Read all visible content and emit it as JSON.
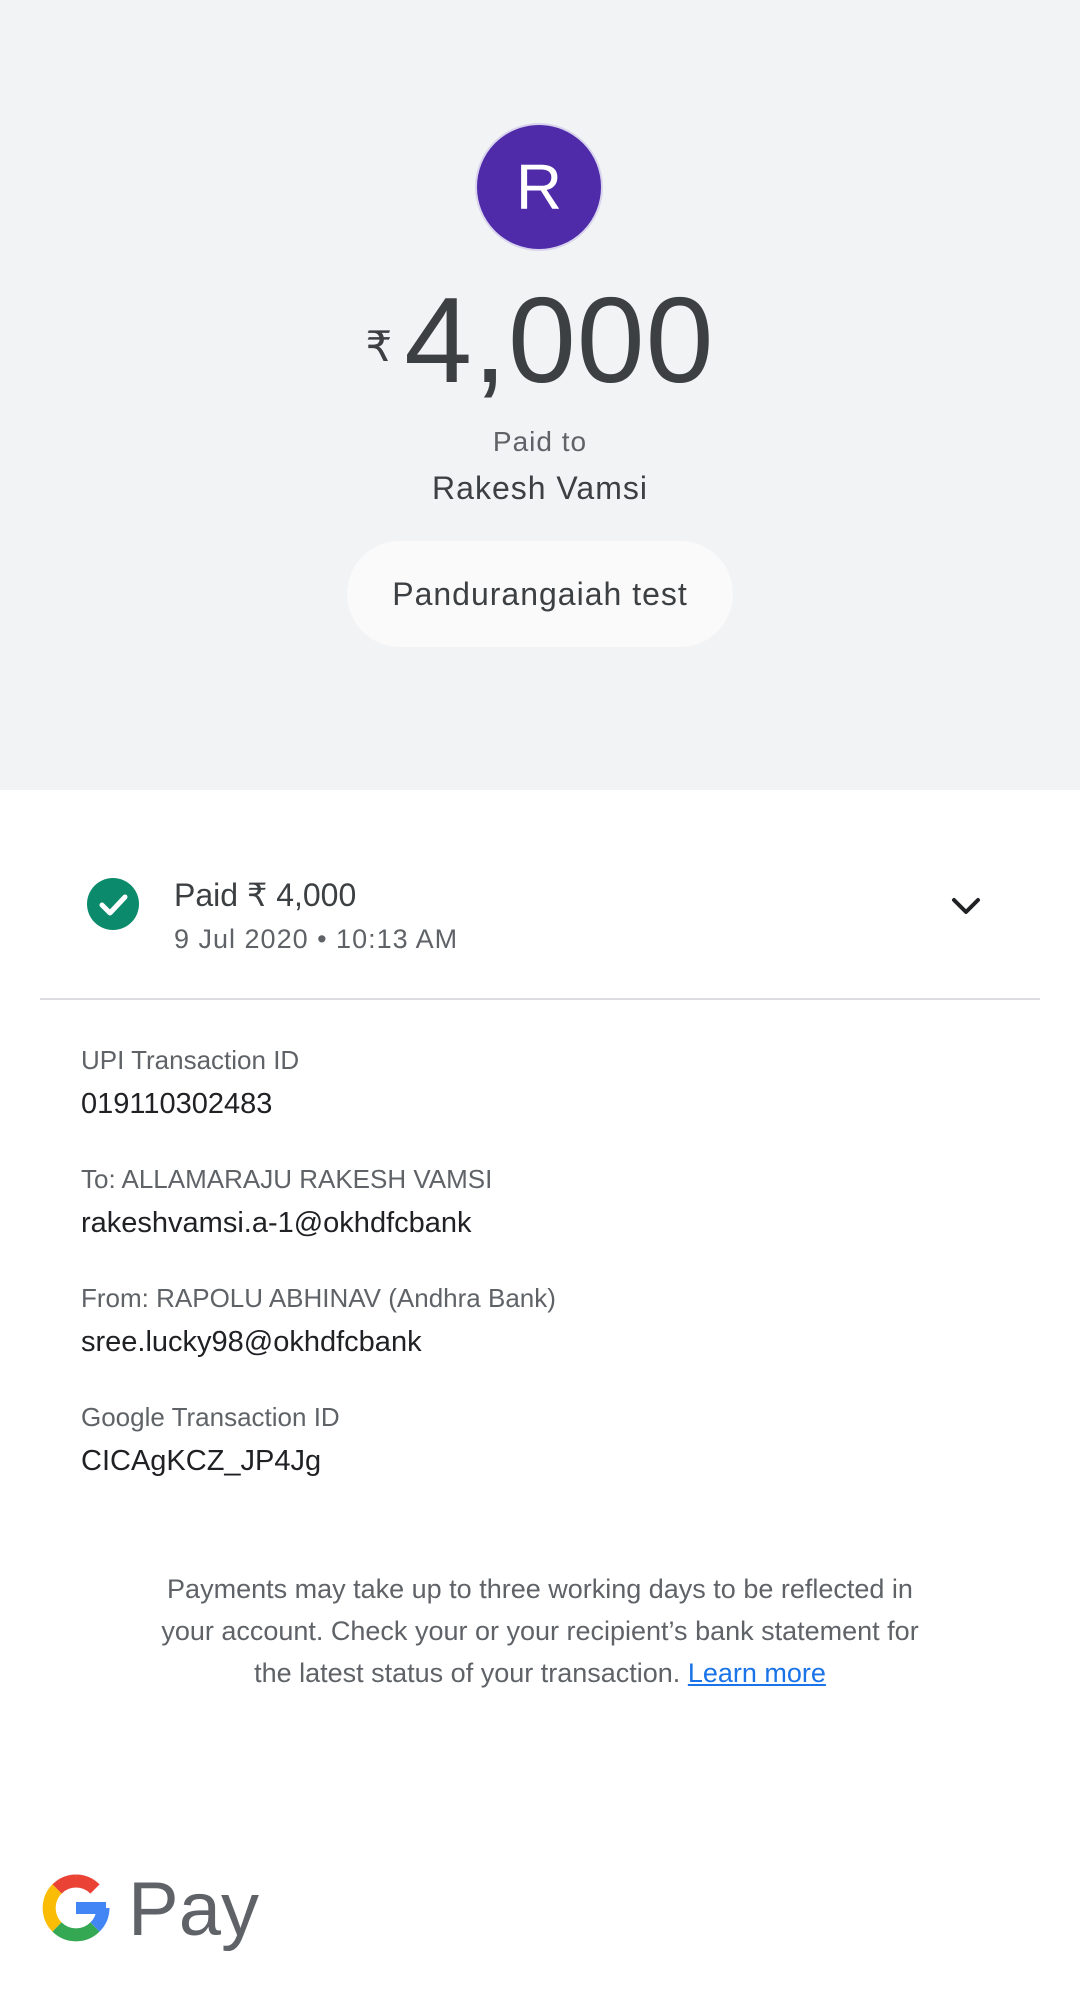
{
  "header": {
    "avatar_initial": "R",
    "avatar_color": "#4f2aa9",
    "currency_symbol": "₹",
    "amount": "4,000",
    "paid_to_label": "Paid to",
    "payee_name": "Rakesh Vamsi",
    "note": "Pandurangaiah test"
  },
  "status": {
    "title": "Paid ₹ 4,000",
    "datetime": "9 Jul 2020 • 10:13 AM",
    "icon": "check-circle-icon",
    "color": "#0b8a6c",
    "expand_icon": "chevron-down-icon"
  },
  "details": [
    {
      "label": "UPI Transaction ID",
      "value": "019110302483"
    },
    {
      "label": "To: ALLAMARAJU RAKESH VAMSI",
      "value": "rakeshvamsi.a-1@okhdfcbank"
    },
    {
      "label": "From: RAPOLU ABHINAV (Andhra Bank)",
      "value": "sree.lucky98@okhdfcbank"
    },
    {
      "label": "Google Transaction ID",
      "value": "CICAgKCZ_JP4Jg"
    }
  ],
  "disclaimer": {
    "text": "Payments may take up to three working days to be reflected in your account. Check your or your recipient’s bank statement for the latest status of your transaction.",
    "link": "Learn more"
  },
  "branding": {
    "logo_text": "Pay"
  }
}
